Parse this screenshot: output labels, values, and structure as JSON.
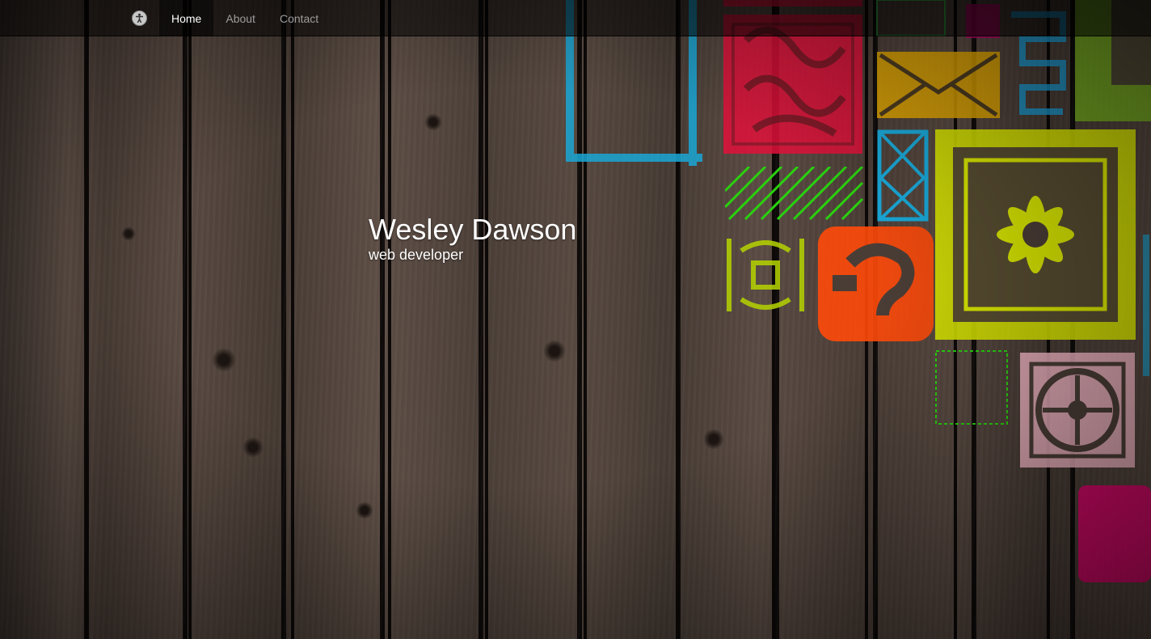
{
  "navbar": {
    "brand_icon": "accessibility-icon",
    "links": [
      {
        "label": "Home",
        "active": true
      },
      {
        "label": "About",
        "active": false
      },
      {
        "label": "Contact",
        "active": false
      }
    ]
  },
  "hero": {
    "title": "Wesley Dawson",
    "subtitle": "web developer"
  },
  "colors": {
    "navbar_bg": "#1a1a1a",
    "nav_active_text": "#ffffff",
    "nav_text": "#9d9d9d",
    "stencil_blue": "#1aa7d6",
    "stencil_red": "#e0103a",
    "stencil_orange": "#ff4a0a",
    "stencil_yellow": "#d8e600",
    "stencil_green": "#2ad10f",
    "stencil_gold": "#e4a800",
    "stencil_pink": "#f4b7c6",
    "stencil_magenta": "#e60068"
  }
}
